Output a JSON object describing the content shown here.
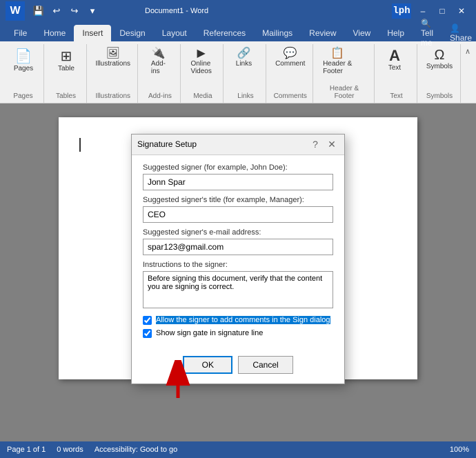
{
  "titleBar": {
    "title": "Document1 - Word",
    "appName": "Word",
    "docName": "Document1",
    "logoText": "W",
    "minimizeLabel": "–",
    "maximizeLabel": "□",
    "closeLabel": "✕"
  },
  "quickAccess": {
    "save": "💾",
    "undo": "↩",
    "redo": "↪",
    "customize": "▾"
  },
  "tabs": [
    {
      "label": "File",
      "active": false
    },
    {
      "label": "Home",
      "active": false
    },
    {
      "label": "Insert",
      "active": true
    },
    {
      "label": "Design",
      "active": false
    },
    {
      "label": "Layout",
      "active": false
    },
    {
      "label": "References",
      "active": false
    },
    {
      "label": "Mailings",
      "active": false
    },
    {
      "label": "Review",
      "active": false
    },
    {
      "label": "View",
      "active": false
    },
    {
      "label": "Help",
      "active": false
    },
    {
      "label": "Tell me",
      "active": false
    },
    {
      "label": "Share",
      "active": false
    }
  ],
  "ribbon": {
    "groups": [
      {
        "name": "Pages",
        "label": "Pages",
        "items": [
          {
            "icon": "📄",
            "label": "Pages"
          }
        ]
      },
      {
        "name": "Tables",
        "label": "Tables",
        "items": [
          {
            "icon": "⊞",
            "label": "Table"
          }
        ]
      },
      {
        "name": "Illustrations",
        "label": "Illustrations",
        "items": [
          {
            "icon": "🖼",
            "label": "Illustrations"
          }
        ]
      },
      {
        "name": "AddIns",
        "label": "Add-ins",
        "items": [
          {
            "icon": "🔌",
            "label": "Add-\nins"
          }
        ]
      },
      {
        "name": "Media",
        "label": "Media",
        "items": [
          {
            "icon": "▶",
            "label": "Online\nVideos"
          }
        ]
      },
      {
        "name": "Links",
        "label": "Links",
        "items": [
          {
            "icon": "🔗",
            "label": "Links"
          }
        ]
      },
      {
        "name": "Comments",
        "label": "Comments",
        "items": [
          {
            "icon": "💬",
            "label": "Comment"
          }
        ]
      },
      {
        "name": "HeaderFooter",
        "label": "Header & Footer",
        "items": [
          {
            "icon": "📋",
            "label": "Header &\nFooter"
          }
        ]
      },
      {
        "name": "Text",
        "label": "Text",
        "items": [
          {
            "icon": "A",
            "label": "Text"
          }
        ]
      },
      {
        "name": "Symbols",
        "label": "Symbols",
        "items": [
          {
            "icon": "Ω",
            "label": "Symbols"
          }
        ]
      }
    ]
  },
  "dialog": {
    "title": "Signature Setup",
    "helpIcon": "?",
    "closeIcon": "✕",
    "fields": {
      "signerLabel": "Suggested signer (for example, John Doe):",
      "signerValue": "Jonn Spar",
      "titleLabel": "Suggested signer's title (for example, Manager):",
      "titleValue": "CEO",
      "emailLabel": "Suggested signer's e-mail address:",
      "emailValue": "spar123@gmail.com",
      "instructionsLabel": "Instructions to the signer:",
      "instructionsValue": "Before signing this document, verify that the content you are signing is correct."
    },
    "checkboxes": [
      {
        "id": "cb1",
        "checked": true,
        "label": "Allow the signer to add comments in the Sign dialog",
        "highlight": true
      },
      {
        "id": "cb2",
        "checked": true,
        "label": "Show sign gate in signature line",
        "highlight": false
      }
    ],
    "buttons": {
      "ok": "OK",
      "cancel": "Cancel"
    }
  },
  "statusBar": {
    "pageInfo": "Page 1 of 1",
    "wordCount": "0 words",
    "accessibility": "Accessibility: Good to go",
    "zoom": "100%"
  }
}
